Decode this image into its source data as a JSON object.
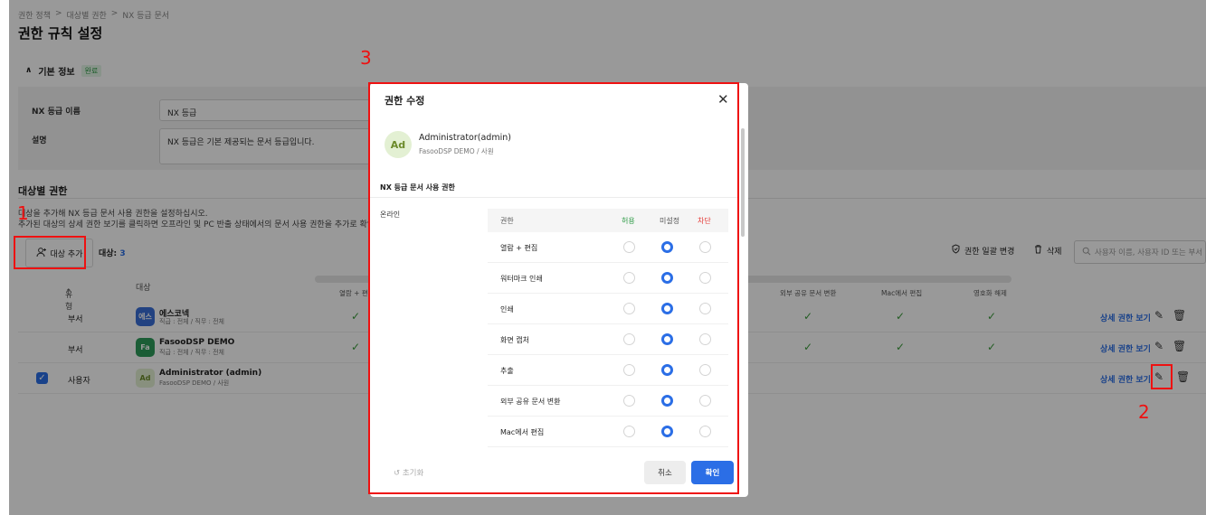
{
  "breadcrumb": [
    "권한 정책",
    ">",
    "대상별 권한",
    ">",
    "NX 등급 문서"
  ],
  "page_title": "권한 규칙 설정",
  "basic_info": {
    "title": "기본 정보",
    "badge": "완료",
    "name_label": "NX 등급 이름",
    "name_value": "NX 등급",
    "desc_label": "설명",
    "desc_value": "NX 등급은 기본 제공되는 문서 등급입니다."
  },
  "target_perm": {
    "title": "대상별 권한",
    "desc1": "대상을 추가해 NX 등급 문서 사용 권한을 설정하십시오.",
    "desc2": "추가된 대상의 상세 권한 보기를 클릭하면 오프라인 및 PC 반출 상태에서의 문서 사용 권한을 추가로 확인할 수",
    "add_button": "대상 추가",
    "count_label": "대상:",
    "count_value": "3",
    "bulk_change": "권한 일괄 변경",
    "delete": "삭제",
    "search_placeholder": "사용자 이름, 사용자 ID 또는 부서"
  },
  "table": {
    "col_type": "유형",
    "col_type_arrow": "↑",
    "col_target": "대상",
    "sub_cols": [
      "열람 + 편집",
      "외부 공유 문서 변환",
      "Mac에서 편집",
      "영호화 해제"
    ],
    "detail_link": "상세 권한 보기",
    "rows": [
      {
        "type": "부서",
        "avatar": "에스",
        "avatar_color": "#3a6fd8",
        "name": "에스코넥",
        "sub": "직급 : 전체 / 직무 : 전체"
      },
      {
        "type": "부서",
        "avatar": "Fa",
        "avatar_color": "#2e9b5a",
        "name": "FasooDSP DEMO",
        "sub": "직급 : 전체 / 직무 : 전체"
      },
      {
        "type": "사용자",
        "avatar": "Ad",
        "avatar_color": "#e3f0d3",
        "name": "Administrator (admin)",
        "sub": "FasooDSP DEMO / 사원"
      }
    ]
  },
  "annotations": {
    "n1": "1",
    "n2": "2",
    "n3": "3"
  },
  "modal": {
    "title": "권한 수정",
    "avatar": "Ad",
    "user_name": "Administrator(admin)",
    "user_org": "FasooDSP DEMO / 사원",
    "section": "NX 등급 문서 사용 권한",
    "mode": "온라인",
    "head_perm": "권한",
    "head_allow": "허용",
    "head_unset": "미설정",
    "head_block": "차단",
    "allow_color": "#2e9b46",
    "block_color": "#e53935",
    "permissions": [
      "열람 + 편집",
      "워터마크 인쇄",
      "인쇄",
      "화면 캡처",
      "추출",
      "외부 공유 문서 변환",
      "Mac에서 편집"
    ],
    "selected": "미설정",
    "reset": "초기화",
    "cancel": "취소",
    "confirm": "확인"
  }
}
